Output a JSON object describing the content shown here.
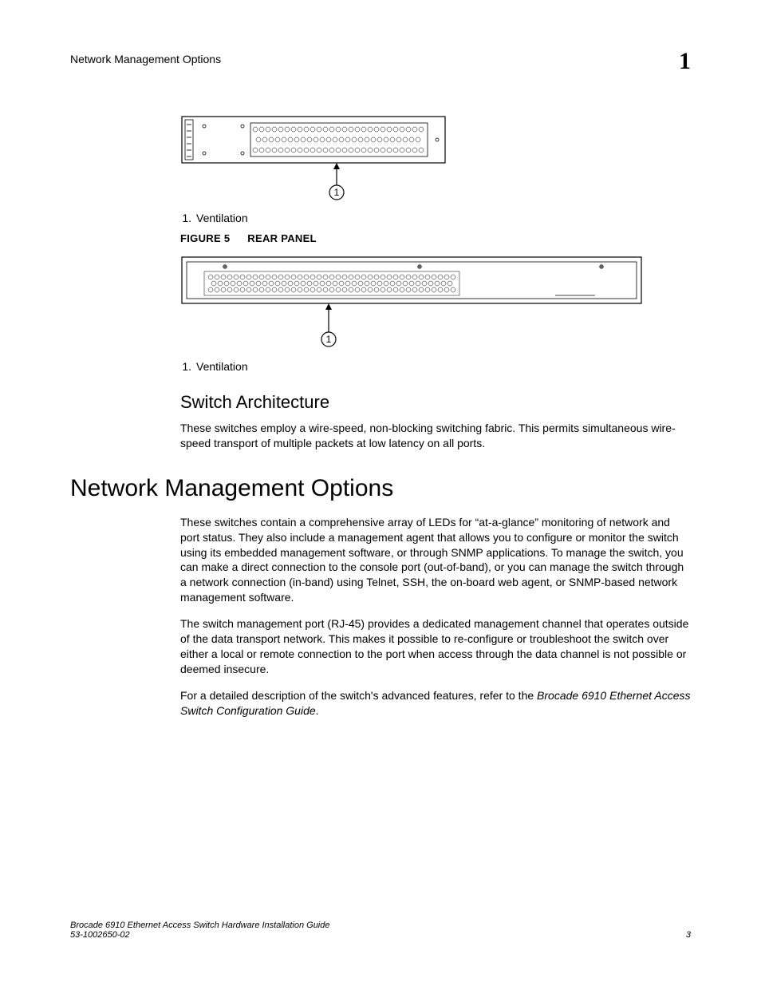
{
  "header": {
    "running_title": "Network Management Options",
    "chapter_number": "1"
  },
  "figure_side": {
    "callout_num": "1.",
    "callout_text": "Ventilation",
    "callout_bubble": "1"
  },
  "figure5": {
    "label": "FIGURE 5",
    "title": "REAR PANEL",
    "callout_num": "1.",
    "callout_text": "Ventilation",
    "callout_bubble": "1"
  },
  "switch_arch": {
    "heading": "Switch Architecture",
    "para": "These switches employ a wire-speed, non-blocking switching fabric. This permits simultaneous wire-speed transport of multiple packets at low latency on all ports."
  },
  "nmo": {
    "heading": "Network Management Options",
    "p1": "These switches contain a comprehensive array of LEDs for “at-a-glance” monitoring of network and port status. They also include a management agent that allows you to configure or monitor the switch using its embedded management software, or through SNMP applications. To manage the switch, you can make a direct connection to the console port (out-of-band), or you can manage the switch through a network connection (in-band) using Telnet, SSH, the on-board web agent, or SNMP-based network management software.",
    "p2": "The switch management port (RJ-45) provides a dedicated management channel that operates outside of the data transport network. This makes it possible to re-configure or troubleshoot the switch over either a local or remote connection to the port when access through the data channel is not possible or deemed insecure.",
    "p3_pre": "For a detailed description of the switch's advanced features, refer to the ",
    "p3_ital": "Brocade 6910 Ethernet Access Switch Configuration Guide",
    "p3_post": "."
  },
  "footer": {
    "line1": "Brocade 6910 Ethernet Access Switch Hardware Installation Guide",
    "line2": "53-1002650-02",
    "page": "3"
  }
}
